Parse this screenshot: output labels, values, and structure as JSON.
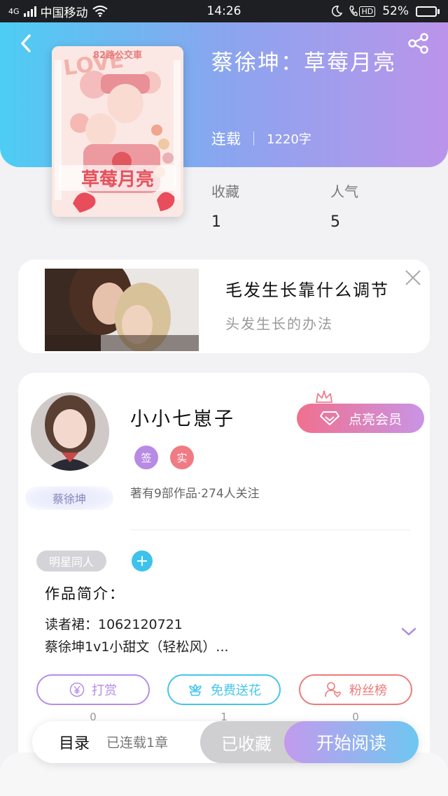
{
  "status_bar": {
    "network": "4G",
    "carrier": "中国移动",
    "time": "14:26",
    "hd": "HD",
    "battery": "52%",
    "battery_level": 0.52
  },
  "book": {
    "title": "蔡徐坤：草莓月亮",
    "status": "连载",
    "word_count": "1220字",
    "cover_text_top": "82路公交車",
    "cover_text_main": "草莓月亮"
  },
  "stats": {
    "favorites_label": "收藏",
    "favorites_value": "1",
    "popularity_label": "人气",
    "popularity_value": "5"
  },
  "ad": {
    "title": "毛发生长靠什么调节",
    "subtitle": "头发生长的办法"
  },
  "author": {
    "name": "小小七崽子",
    "badge": "蔡徐坤",
    "tag1": "签",
    "tag2": "实",
    "meta": "著有9部作品·274人关注",
    "vip_label": "点亮会员",
    "colors": {
      "tag1": "#b78ae4",
      "tag2": "#f07b84"
    }
  },
  "work": {
    "category": "明星同人",
    "intro_title": "作品简介：",
    "intro_line1": "读者裙：1062120721",
    "intro_line2": "蔡徐坤1v1小甜文（轻松风）..."
  },
  "actions": {
    "tip_label": "打赏",
    "tip_count": "0",
    "flower_label": "免费送花",
    "flower_count": "1",
    "fans_label": "粉丝榜",
    "fans_count": "0",
    "colors": {
      "tip": "#b58de6",
      "flower": "#45c5ec",
      "fans": "#ee7a7a"
    }
  },
  "bottom_bar": {
    "toc_label": "目录",
    "toc_sub": "已连载1章",
    "collected_label": "已收藏",
    "read_label": "开始阅读"
  }
}
